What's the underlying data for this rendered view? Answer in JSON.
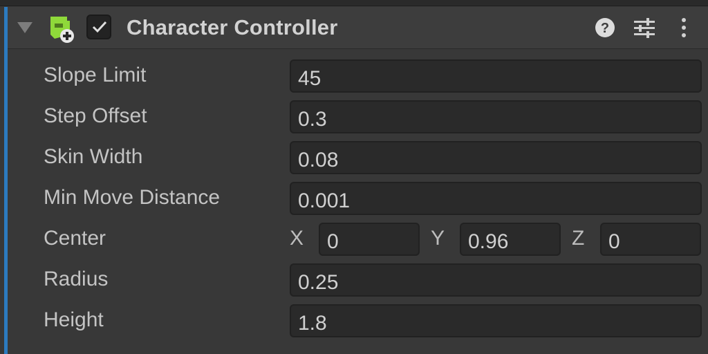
{
  "component": {
    "title": "Character Controller",
    "enabled": true,
    "icon": "character-controller-icon",
    "header_icons": [
      "help-icon",
      "presets-icon",
      "more-menu-icon"
    ]
  },
  "properties": [
    {
      "label": "Slope Limit",
      "value": "45"
    },
    {
      "label": "Step Offset",
      "value": "0.3"
    },
    {
      "label": "Skin Width",
      "value": "0.08"
    },
    {
      "label": "Min Move Distance",
      "value": "0.001"
    },
    {
      "label": "Center",
      "x_label": "X",
      "x": "0",
      "y_label": "Y",
      "y": "0.96",
      "z_label": "Z",
      "z": "0"
    },
    {
      "label": "Radius",
      "value": "0.25"
    },
    {
      "label": "Height",
      "value": "1.8"
    }
  ],
  "colors": {
    "accent": "#2c7bc0",
    "icon_green": "#8fd93a",
    "background": "#383838",
    "field": "#2a2a2a"
  }
}
